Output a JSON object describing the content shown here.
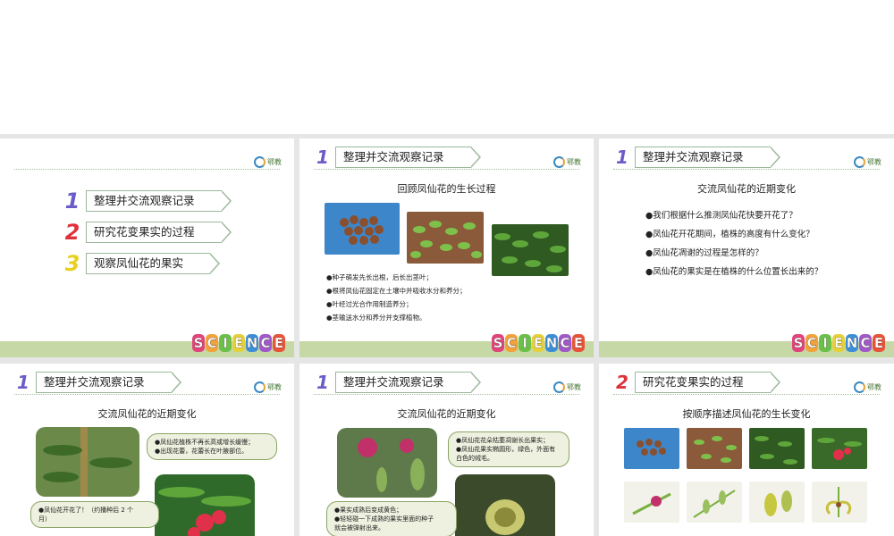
{
  "logo_text": "鄂教",
  "science_letters": [
    "S",
    "C",
    "I",
    "E",
    "N",
    "C",
    "E"
  ],
  "science_colors": [
    "#e0447a",
    "#f2a23a",
    "#6cc04a",
    "#e6d13a",
    "#3c8fd6",
    "#a05ac8",
    "#e8543a"
  ],
  "slide1": {
    "menu": [
      {
        "num": "1",
        "label": "整理并交流观察记录",
        "color": "#6a5cc8"
      },
      {
        "num": "2",
        "label": "研究花变果实的过程",
        "color": "#e0303a"
      },
      {
        "num": "3",
        "label": "观察凤仙花的果实",
        "color": "#e8d020"
      }
    ]
  },
  "slide2": {
    "header_num": "1",
    "header": "整理并交流观察记录",
    "subtitle": "回顾凤仙花的生长过程",
    "bullets": [
      "●种子萌发先长出根，后长出茎叶；",
      "●根将凤仙花固定在土壤中并吸收水分和养分；",
      "●叶经过光合作用制造养分；",
      "●茎输送水分和养分并支撑植物。"
    ]
  },
  "slide3": {
    "header_num": "1",
    "header": "整理并交流观察记录",
    "subtitle": "交流凤仙花的近期变化",
    "bullets": [
      "●我们根据什么推测凤仙花快要开花了？",
      "●凤仙花开花期间，植株的高度有什么变化？",
      "●凤仙花凋谢的过程是怎样的？",
      "●凤仙花的果实是在植株的什么位置长出来的？"
    ]
  },
  "slide4": {
    "header_num": "1",
    "header": "整理并交流观察记录",
    "subtitle": "交流凤仙花的近期变化",
    "callout1": [
      "●凤仙花植株不再长高或增长缓慢；",
      "●出现花蕾，花蕾长在叶腋部位。"
    ],
    "callout2": [
      "●凤仙花开花了！（约播种后 2 个",
      "月）"
    ]
  },
  "slide5": {
    "header_num": "1",
    "header": "整理并交流观察记录",
    "subtitle": "交流凤仙花的近期变化",
    "callout1": [
      "●凤仙花花朵枯萎凋谢长出果实；",
      "●凤仙花果实椭圆形，绿色，外面有",
      "白色的绒毛。"
    ],
    "callout2": [
      "●果实成熟后变成黄色；",
      "●轻轻碰一下成熟的果实里面的种子",
      "就会被弹射出来。"
    ]
  },
  "slide6": {
    "header_num": "2",
    "header": "研究花变果实的过程",
    "subtitle": "按顺序描述凤仙花的生长变化"
  }
}
